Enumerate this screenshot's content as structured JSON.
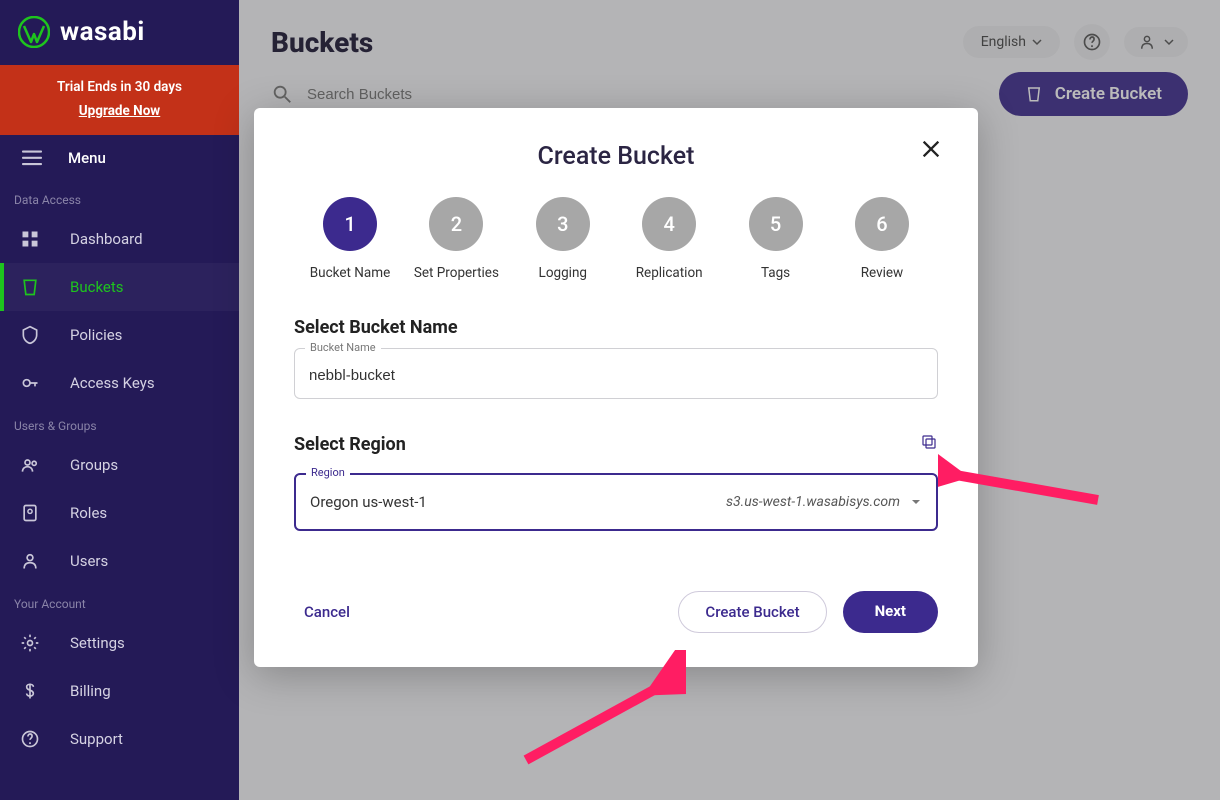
{
  "brand": {
    "name": "wasabi"
  },
  "trial": {
    "line1": "Trial Ends in 30 days",
    "line2": "Upgrade Now"
  },
  "menu": {
    "label": "Menu"
  },
  "sidebar": {
    "sections": {
      "data_access": "Data Access",
      "users_groups": "Users & Groups",
      "your_account": "Your Account"
    },
    "items": {
      "dashboard": "Dashboard",
      "buckets": "Buckets",
      "policies": "Policies",
      "access_keys": "Access Keys",
      "groups": "Groups",
      "roles": "Roles",
      "users": "Users",
      "settings": "Settings",
      "billing": "Billing",
      "support": "Support"
    }
  },
  "header": {
    "page_title": "Buckets",
    "language": "English",
    "search_placeholder": "Search Buckets",
    "create_button": "Create Bucket"
  },
  "modal": {
    "title": "Create Bucket",
    "steps": [
      {
        "num": "1",
        "label": "Bucket Name"
      },
      {
        "num": "2",
        "label": "Set Properties"
      },
      {
        "num": "3",
        "label": "Logging"
      },
      {
        "num": "4",
        "label": "Replication"
      },
      {
        "num": "5",
        "label": "Tags"
      },
      {
        "num": "6",
        "label": "Review"
      }
    ],
    "select_bucket_name_title": "Select Bucket Name",
    "bucket_name_label": "Bucket Name",
    "bucket_name_value": "nebbl-bucket",
    "select_region_title": "Select Region",
    "region_label": "Region",
    "region_value": "Oregon us-west-1",
    "region_endpoint": "s3.us-west-1.wasabisys.com",
    "cancel": "Cancel",
    "create_bucket": "Create Bucket",
    "next": "Next"
  },
  "colors": {
    "primary": "#3c2a8e",
    "sidebar_bg": "#241a57",
    "accent_green": "#1ec41e",
    "trial_bg": "#c33118"
  }
}
